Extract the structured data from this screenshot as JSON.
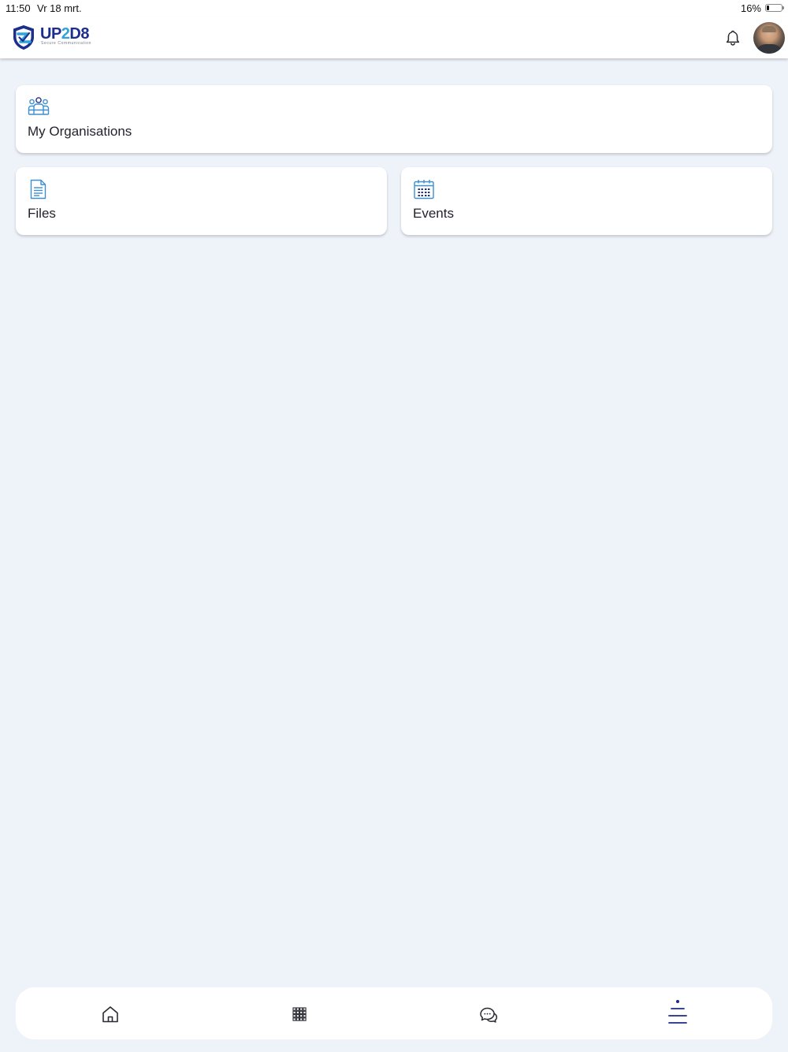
{
  "status_bar": {
    "time": "11:50",
    "date": "Vr 18 mrt.",
    "battery": "16%",
    "battery_level": 0.16
  },
  "header": {
    "logo": {
      "word_main": "UP",
      "word_accent": "2",
      "word_end": "D8",
      "tagline": "Secure Communication"
    },
    "notification_icon": "bell-icon",
    "avatar": "user-avatar"
  },
  "cards": [
    {
      "label": "My Organisations",
      "icon": "organisations-icon"
    },
    {
      "label": "Files",
      "icon": "document-icon"
    },
    {
      "label": "Events",
      "icon": "calendar-icon"
    }
  ],
  "bottom_nav": {
    "items": [
      {
        "icon": "home-icon"
      },
      {
        "icon": "grid-icon"
      },
      {
        "icon": "chat-icon"
      },
      {
        "icon": "menu-icon",
        "active": true
      }
    ]
  },
  "colors": {
    "background": "#eef2f9",
    "brand_dark": "#1d2f8c",
    "brand_light": "#2fa3dc",
    "card_icon": "#3d8fd0",
    "active_nav": "#1d2a8a"
  }
}
